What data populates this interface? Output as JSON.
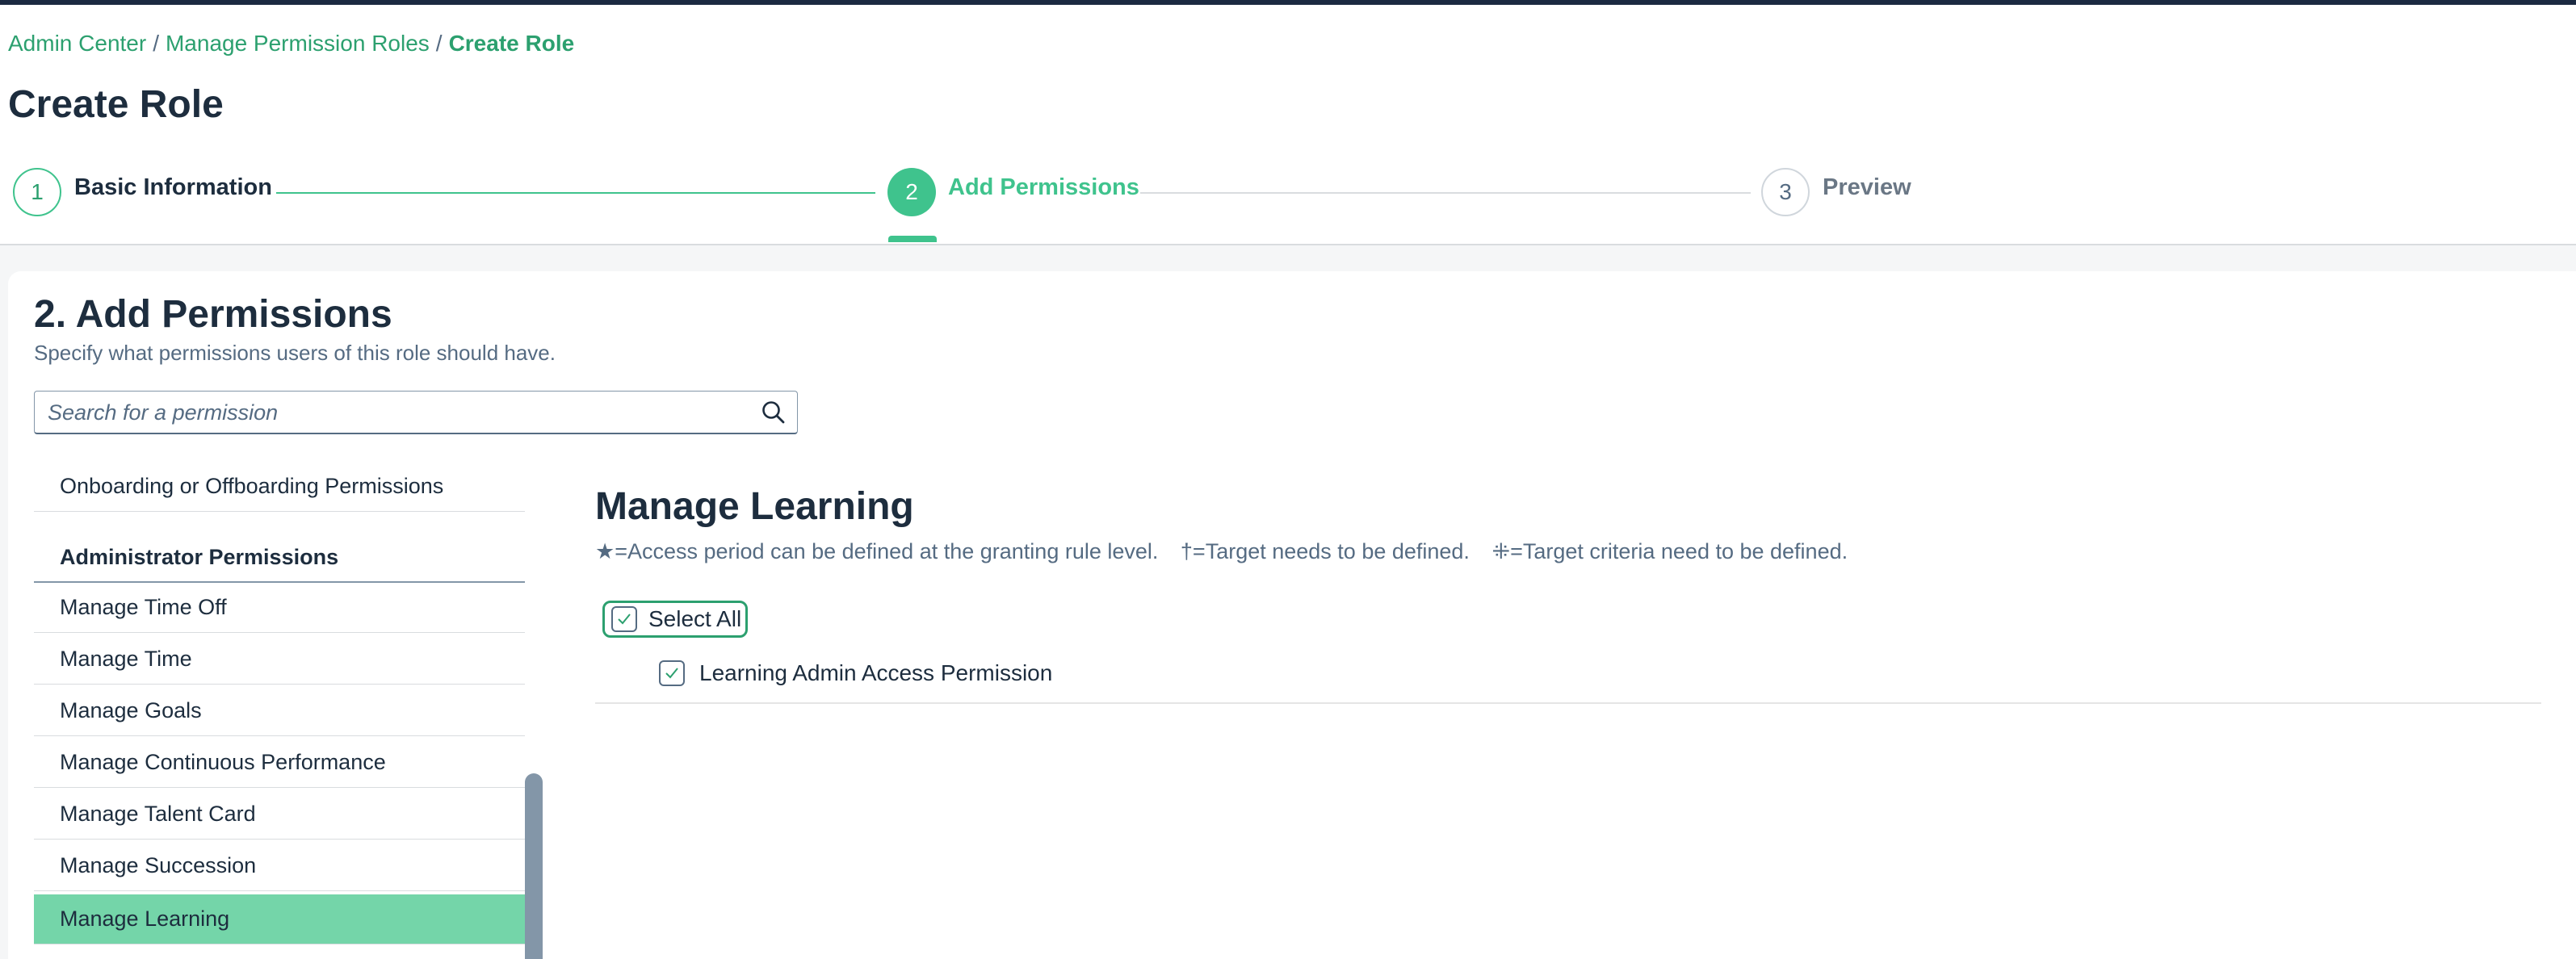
{
  "breadcrumb": {
    "items": [
      "Admin Center",
      "Manage Permission Roles",
      "Create Role"
    ],
    "separator": "/"
  },
  "page_title": "Create Role",
  "wizard": {
    "steps": [
      {
        "number": "1",
        "label": "Basic Information",
        "state": "completed"
      },
      {
        "number": "2",
        "label": "Add Permissions",
        "state": "active"
      },
      {
        "number": "3",
        "label": "Preview",
        "state": "upcoming"
      }
    ]
  },
  "section": {
    "title": "2. Add Permissions",
    "subtitle": "Specify what permissions users of this role should have."
  },
  "search": {
    "placeholder": "Search for a permission",
    "value": "",
    "icon": "search-icon"
  },
  "permission_list": {
    "items": [
      {
        "label": "Onboarding or Offboarding Permissions",
        "type": "item"
      },
      {
        "label": "Administrator Permissions",
        "type": "group"
      },
      {
        "label": "Manage Time Off",
        "type": "item"
      },
      {
        "label": "Manage Time",
        "type": "item"
      },
      {
        "label": "Manage Goals",
        "type": "item"
      },
      {
        "label": "Manage Continuous Performance",
        "type": "item"
      },
      {
        "label": "Manage Talent Card",
        "type": "item"
      },
      {
        "label": "Manage Succession",
        "type": "item"
      },
      {
        "label": "Manage Learning",
        "type": "item",
        "selected": true
      }
    ]
  },
  "detail": {
    "title": "Manage Learning",
    "legend": [
      "★=Access period can be defined at the granting rule level.",
      "†=Target needs to be defined.",
      "⁜=Target criteria need to be defined."
    ],
    "select_all": {
      "label": "Select All",
      "checked": true
    },
    "permissions": [
      {
        "label": "Learning Admin Access Permission",
        "checked": true
      }
    ]
  },
  "colors": {
    "accent": "#3fc38d",
    "accent_dark": "#2ca06f",
    "selected_row": "#74d5a9",
    "text": "#1d2d3e",
    "muted": "#556b82"
  }
}
